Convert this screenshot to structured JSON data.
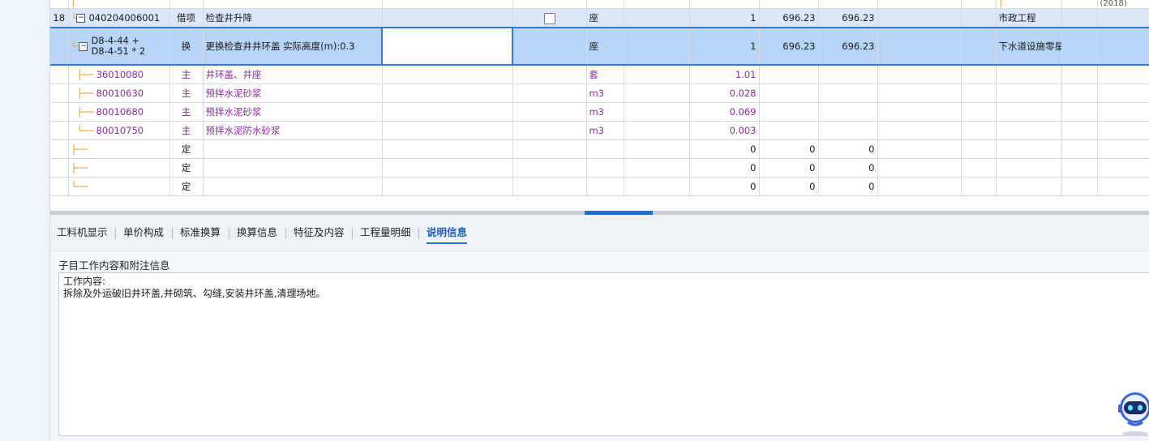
{
  "grid": {
    "top_stub_text": "(2018)",
    "rows": [
      {
        "id": "r18",
        "seq": "18",
        "code": "040204006001",
        "cat": "借项",
        "name": "检查井升降",
        "unit": "座",
        "qty": "1",
        "price": "696.23",
        "total": "696.23",
        "spec": "市政工程"
      },
      {
        "id": "rsel",
        "code_line1": "D8-4-44 +",
        "code_line2": "D8-4-51 * 2",
        "cat": "换",
        "name": "更换检查井井环盖  实际高度(m):0.3",
        "unit": "座",
        "qty": "1",
        "price": "696.23",
        "total": "696.23",
        "spec": "下水道设施零星修补、日常巡查"
      },
      {
        "id": "m1",
        "code": "36010080",
        "cat": "主",
        "name": "井环盖、井座",
        "unit": "套",
        "qty": "1.01"
      },
      {
        "id": "m2",
        "code": "80010630",
        "cat": "主",
        "name": "预拌水泥砂浆",
        "unit": "m3",
        "qty": "0.028"
      },
      {
        "id": "m3",
        "code": "80010680",
        "cat": "主",
        "name": "预拌水泥砂浆",
        "unit": "m3",
        "qty": "0.069"
      },
      {
        "id": "m4",
        "code": "80010750",
        "cat": "主",
        "name": "预拌水泥防水砂浆",
        "unit": "m3",
        "qty": "0.003"
      },
      {
        "id": "d1",
        "cat": "定",
        "qty": "0",
        "price": "0",
        "total": "0"
      },
      {
        "id": "d2",
        "cat": "定",
        "qty": "0",
        "price": "0",
        "total": "0"
      },
      {
        "id": "d3",
        "cat": "定",
        "qty": "0",
        "price": "0",
        "total": "0"
      }
    ]
  },
  "tabs": [
    "工料机显示",
    "单价构成",
    "标准换算",
    "换算信息",
    "特征及内容",
    "工程量明细",
    "说明信息"
  ],
  "active_tab": "说明信息",
  "panel": {
    "title": "子目工作内容和附注信息",
    "line1": "工作内容:",
    "line2": "拆除及外运破旧井环盖,井砌筑、勾缝,安装井环盖,清理场地。"
  },
  "colors": {
    "accent": "#1f6fd1",
    "selected_row": "#b8d4f6",
    "parent_row": "#dce8fa",
    "material_text": "#8b2c9e",
    "tree_line": "#e0962f"
  },
  "icons": {
    "collapse": "minus-box-icon",
    "assistant": "robot-assistant-icon"
  }
}
